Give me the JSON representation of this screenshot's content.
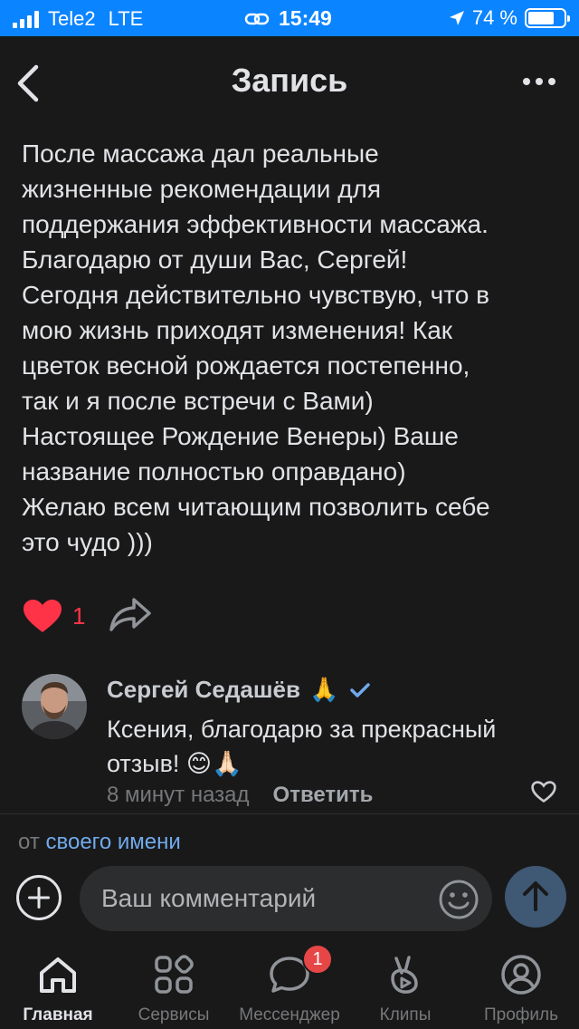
{
  "status_bar": {
    "carrier": "Tele2",
    "network": "LTE",
    "time": "15:49",
    "battery_percent": "74 %",
    "battery_level": 0.74
  },
  "header": {
    "title": "Запись"
  },
  "post": {
    "text_lines": [
      "После массажа дал реальные",
      "жизненные рекомендации для",
      "поддержания эффективности массажа.",
      "Благодарю от души Вас, Сергей!",
      "Сегодня действительно чувствую, что в",
      "мою жизнь приходят изменения! Как",
      "цветок весной рождается постепенно,",
      "так и я после встречи с Вами)",
      "Настоящее Рождение Венеры) Ваше",
      "название полностью оправдано)",
      "Желаю всем читающим позволить себе",
      "это чудо )))"
    ],
    "like_count": "1"
  },
  "comment": {
    "author": "Сергей Седашёв",
    "author_emoji": "🙏",
    "text": "Ксения, благодарю за прекрасный отзыв! 😊🙏🏻",
    "time": "8 минут назад",
    "reply_label": "Ответить"
  },
  "composer": {
    "from_prefix": "от",
    "from_link": "своего имени",
    "placeholder": "Ваш комментарий"
  },
  "tabbar": {
    "tabs": [
      {
        "label": "Главная",
        "icon": "home-icon",
        "active": true
      },
      {
        "label": "Сервисы",
        "icon": "services-icon",
        "active": false
      },
      {
        "label": "Мессенджер",
        "icon": "messenger-icon",
        "active": false,
        "badge": "1"
      },
      {
        "label": "Клипы",
        "icon": "clips-icon",
        "active": false
      },
      {
        "label": "Профиль",
        "icon": "profile-icon",
        "active": false
      }
    ]
  },
  "colors": {
    "background": "#19191a",
    "status_bar": "#0b84ff",
    "like_red": "#ff3347",
    "link_blue": "#71aaeb",
    "verified_blue": "#71aaeb",
    "badge_red": "#e64646"
  }
}
